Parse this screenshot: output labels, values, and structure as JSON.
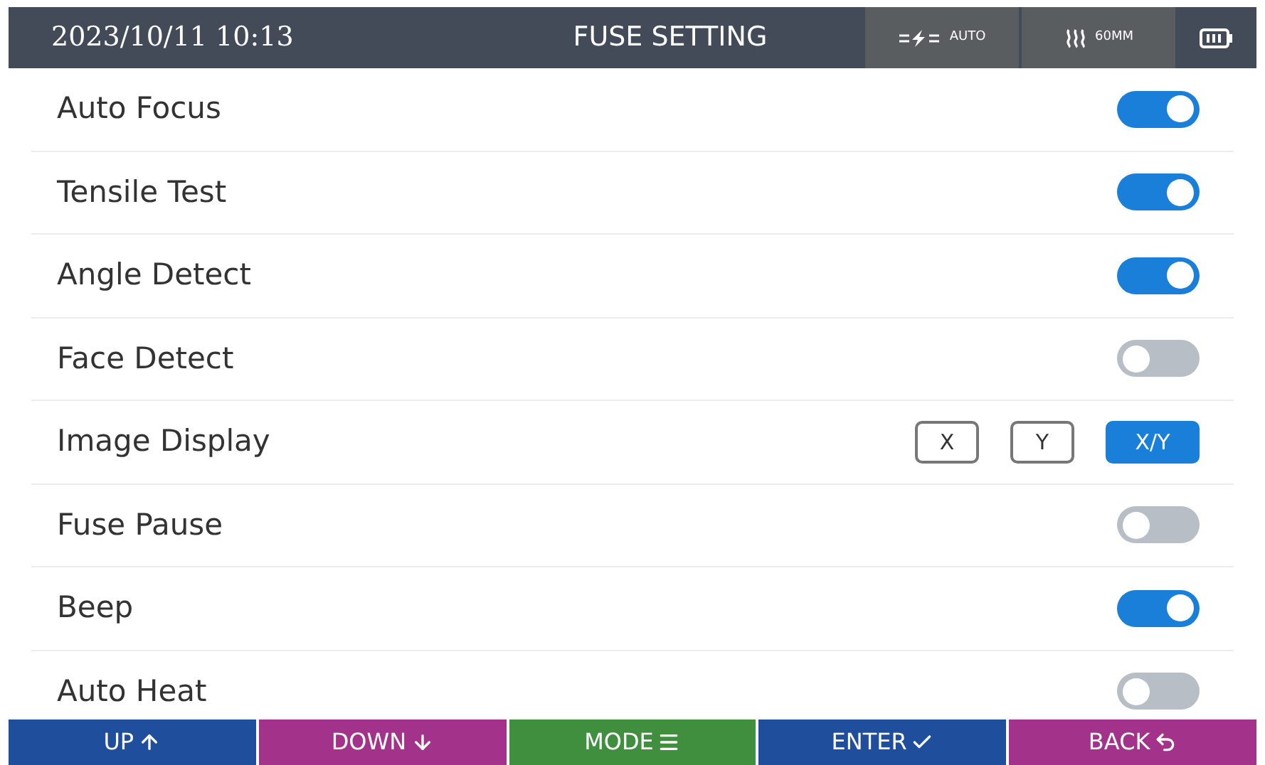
{
  "header": {
    "datetime": "2023/10/11 10:13",
    "title": "FUSE SETTING",
    "status": [
      {
        "kind": "arc",
        "label": "AUTO"
      },
      {
        "kind": "heat",
        "label": "60MM"
      }
    ]
  },
  "settings": [
    {
      "kind": "toggle",
      "label": "Auto Focus",
      "on": true
    },
    {
      "kind": "toggle",
      "label": "Tensile Test",
      "on": true
    },
    {
      "kind": "toggle",
      "label": "Angle Detect",
      "on": true
    },
    {
      "kind": "toggle",
      "label": "Face Detect",
      "on": false
    },
    {
      "kind": "choice",
      "label": "Image Display",
      "options": [
        {
          "label": "X",
          "selected": false
        },
        {
          "label": "Y",
          "selected": false
        },
        {
          "label": "X/Y",
          "selected": true
        }
      ]
    },
    {
      "kind": "toggle",
      "label": "Fuse Pause",
      "on": false
    },
    {
      "kind": "toggle",
      "label": "Beep",
      "on": true
    },
    {
      "kind": "toggle",
      "label": "Auto Heat",
      "on": false
    }
  ],
  "footer": [
    {
      "kind": "up",
      "label": "UP",
      "color": "#1f4e9c"
    },
    {
      "kind": "down",
      "label": "DOWN",
      "color": "#a3338a"
    },
    {
      "kind": "mode",
      "label": "MODE",
      "color": "#3f8f3f"
    },
    {
      "kind": "enter",
      "label": "ENTER",
      "color": "#1f4e9c"
    },
    {
      "kind": "back",
      "label": "BACK",
      "color": "#a3338a"
    }
  ]
}
